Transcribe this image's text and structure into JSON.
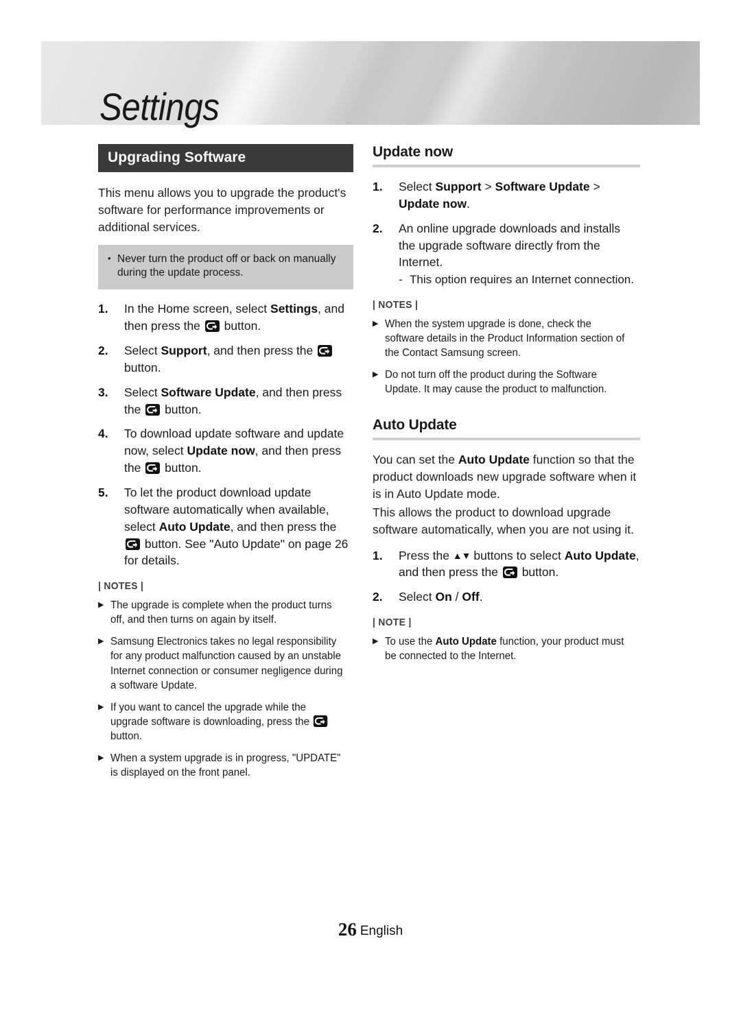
{
  "banner": {
    "title": "Settings"
  },
  "left_column": {
    "section_title": "Upgrading Software",
    "intro": "This menu allows you to upgrade the product's software for performance improvements or additional services.",
    "caution": {
      "bullet": "•",
      "text": "Never turn the product off or back on manually during the update process."
    },
    "steps": [
      {
        "num": "1.",
        "pre": "In the Home screen, select ",
        "bold": "Settings",
        "mid": ", and then press the ",
        "icon": "enter-button-icon",
        "post": " button."
      },
      {
        "num": "2.",
        "pre": "Select ",
        "bold": "Support",
        "mid": ", and then press the ",
        "icon": "enter-button-icon",
        "post": " button."
      },
      {
        "num": "3.",
        "pre": "Select ",
        "bold": "Software Update",
        "mid": ", and then press the ",
        "icon": "enter-button-icon",
        "post": " button."
      },
      {
        "num": "4.",
        "pre": "To download update software and update now, select ",
        "bold": "Update now",
        "mid": ", and then press the ",
        "icon": "enter-button-icon",
        "post": " button."
      },
      {
        "num": "5.",
        "pre": "To let the product download update software automatically when available, select ",
        "bold": "Auto Update",
        "mid": ", and then press the ",
        "icon": "enter-button-icon",
        "post": " button. See \"Auto Update\" on page 26 for details."
      }
    ],
    "notes_label": "| NOTES |",
    "notes": [
      {
        "marker": "▶",
        "text": "The upgrade is complete when the product turns off, and then turns on again by itself."
      },
      {
        "marker": "▶",
        "text": "Samsung Electronics takes no legal responsibility for any product malfunction caused by an unstable Internet connection or consumer negligence during a software Update."
      },
      {
        "marker": "▶",
        "pre": "If you want to cancel the upgrade while the upgrade software is downloading, press the ",
        "icon": "enter-button-icon",
        "post": " button."
      },
      {
        "marker": "▶",
        "text": "When a system upgrade is in progress, \"UPDATE\" is displayed on the front panel."
      }
    ]
  },
  "right_column": {
    "update_now": {
      "heading": "Update now",
      "steps": [
        {
          "num": "1.",
          "pre": "Select ",
          "bold1": "Support",
          "sep1": " > ",
          "bold2": "Software Update",
          "sep2": " > ",
          "bold3": "Update now",
          "post": "."
        },
        {
          "num": "2.",
          "text": "An online upgrade downloads and installs the upgrade software directly from the Internet.",
          "substep_dash": "-",
          "substep": "This option requires an Internet connection."
        }
      ],
      "notes_label": "| NOTES |",
      "notes": [
        {
          "marker": "▶",
          "text": "When the system upgrade is done, check the software details in the Product Information section of the Contact Samsung screen."
        },
        {
          "marker": "▶",
          "text": "Do not turn off the product during the Software Update. It may cause the product to malfunction."
        }
      ]
    },
    "auto_update": {
      "heading": "Auto Update",
      "para1_pre": "You can set the ",
      "para1_bold": "Auto Update",
      "para1_post": " function so that the product downloads new upgrade software when it is in Auto Update mode.",
      "para2": "This allows the product to download upgrade software automatically, when you are not using it.",
      "steps": [
        {
          "num": "1.",
          "pre": "Press the ",
          "arrows": "▲▼",
          "mid": " buttons to select ",
          "bold": "Auto Update",
          "mid2": ", and then press the ",
          "icon": "enter-button-icon",
          "post": " button."
        },
        {
          "num": "2.",
          "pre": "Select ",
          "bold1": "On",
          "sep": " / ",
          "bold2": "Off",
          "post": "."
        }
      ],
      "notes_label": "| NOTE |",
      "notes": [
        {
          "marker": "▶",
          "pre": "To use the ",
          "bold": "Auto Update",
          "post": " function, your product must be connected to the Internet."
        }
      ]
    }
  },
  "footer": {
    "page_number": "26",
    "language": "English"
  },
  "colors": {
    "section_bar_bg": "#3a3a3a",
    "caution_bg": "#cbcbcb",
    "rule": "#cfcfcf",
    "text": "#1a1a1a"
  }
}
